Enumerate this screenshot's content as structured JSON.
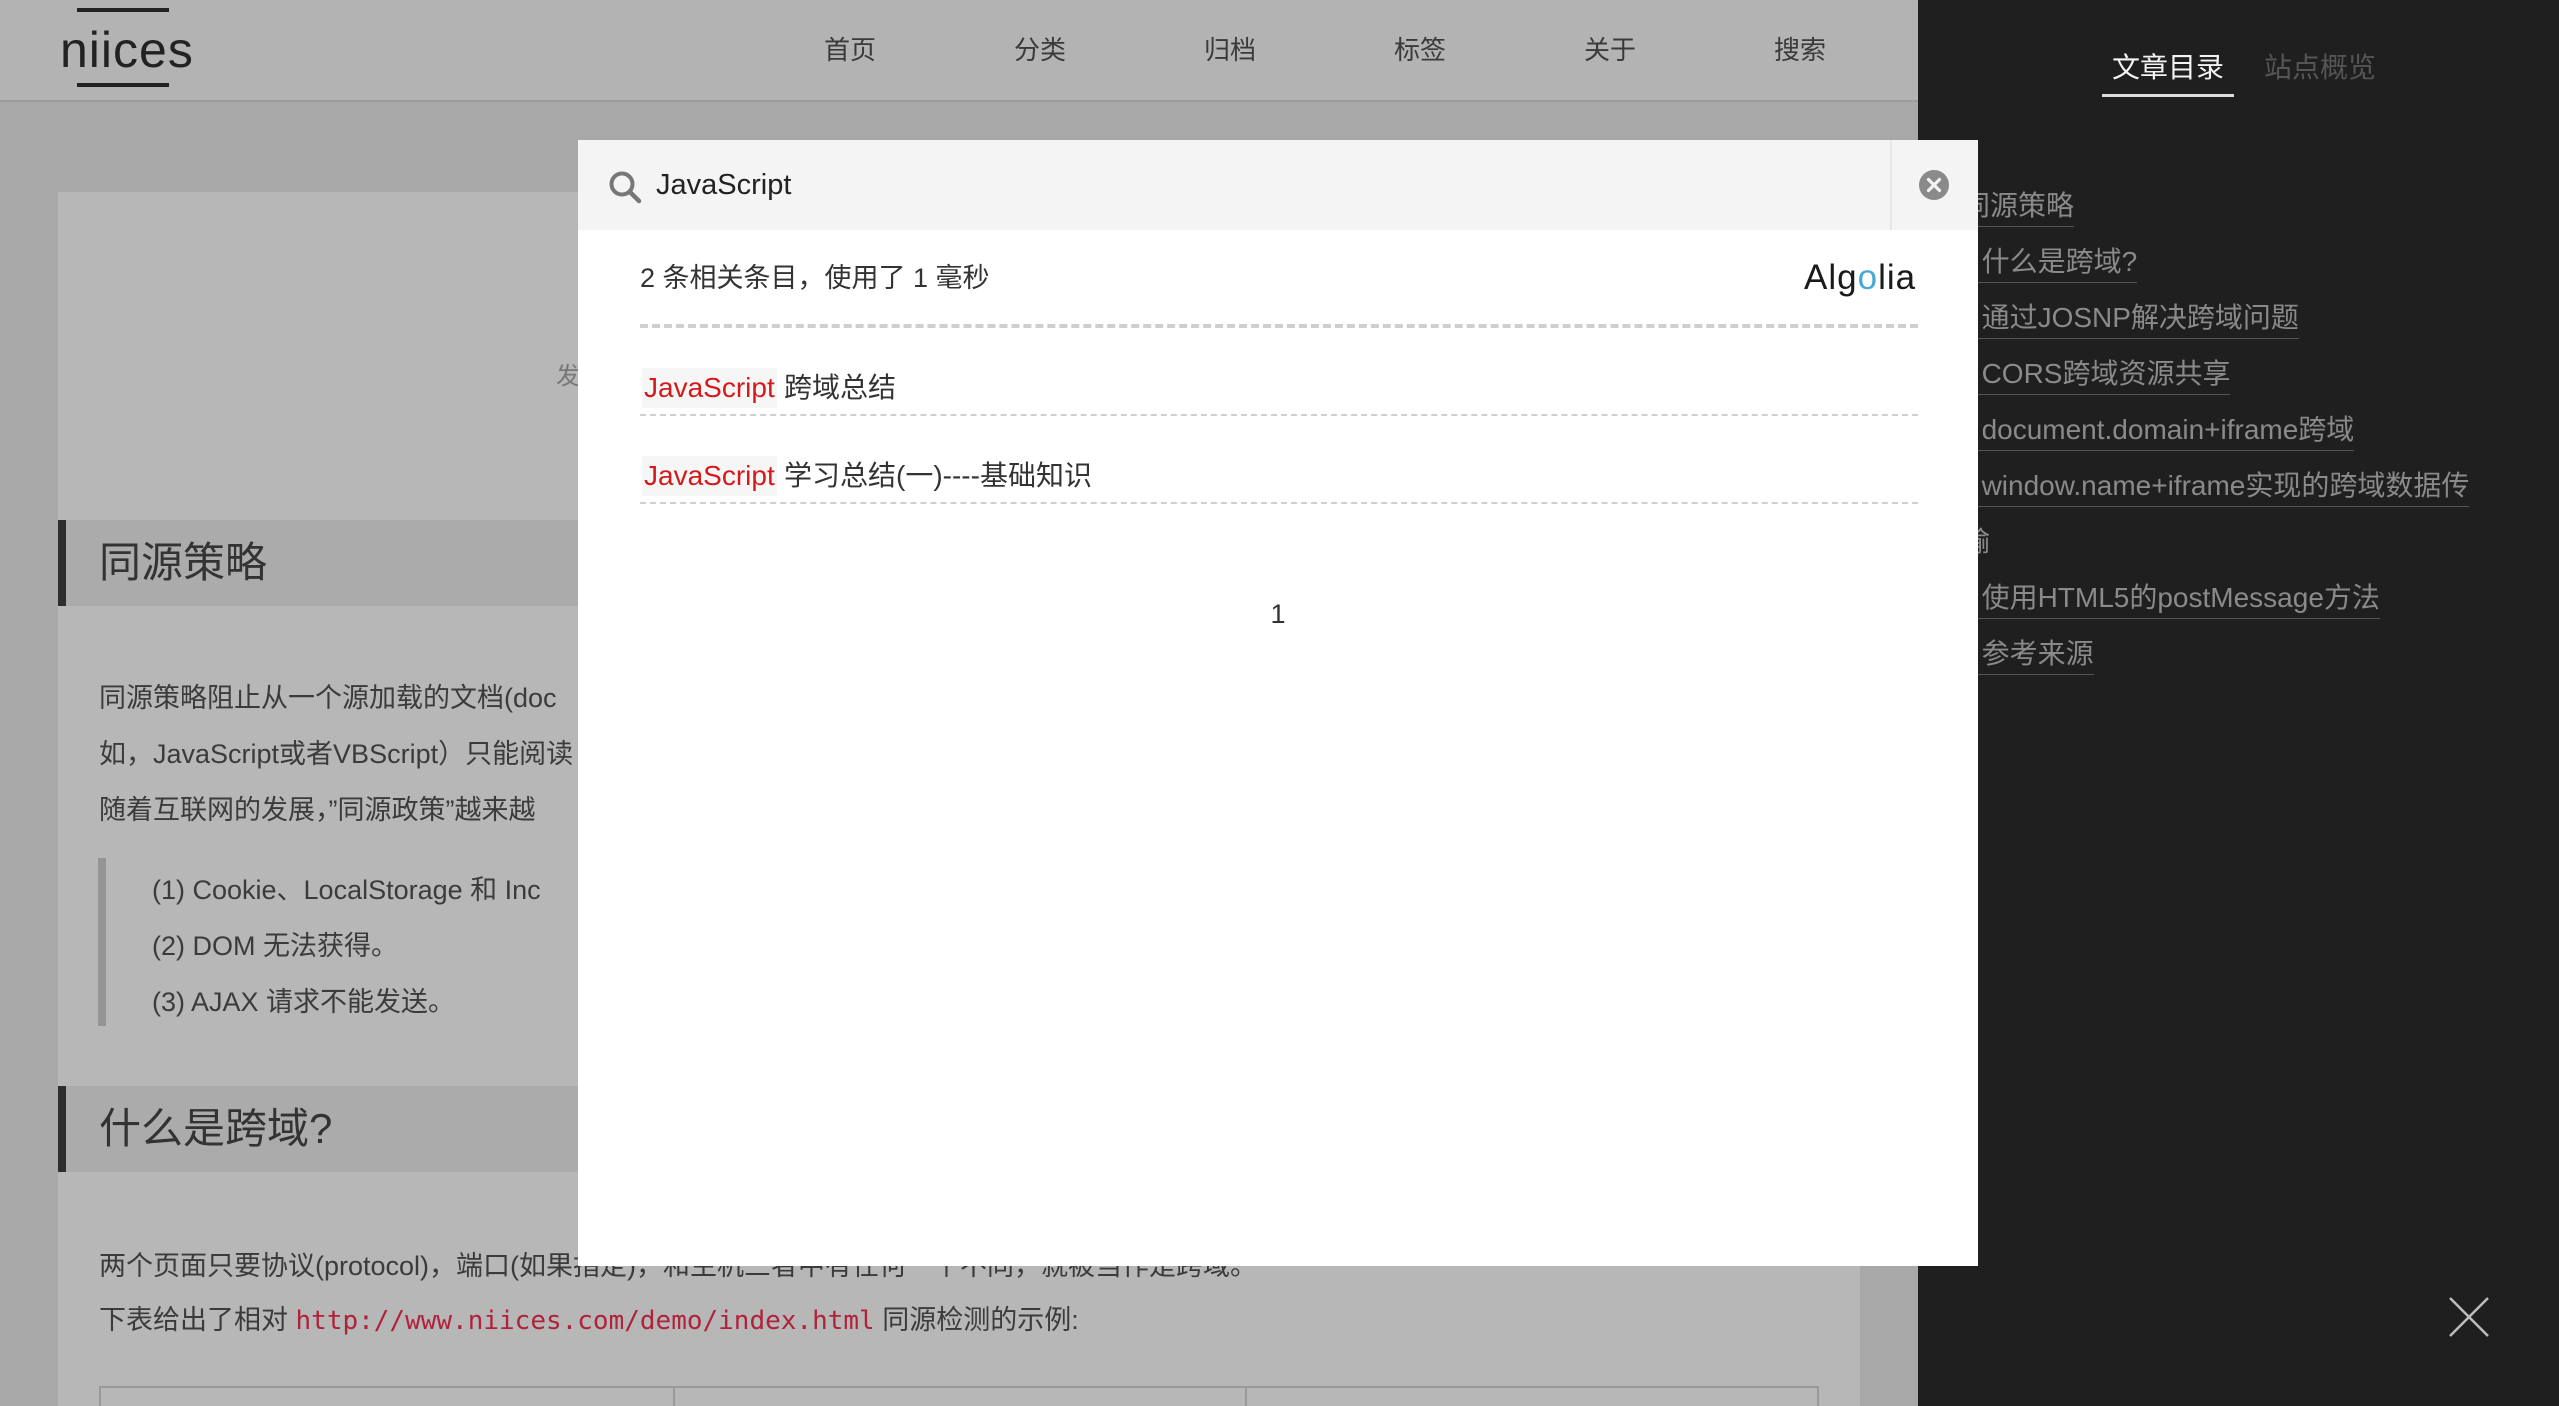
{
  "header": {
    "logo_text": "niices",
    "nav": [
      "首页",
      "分类",
      "归档",
      "标签",
      "关于",
      "搜索"
    ]
  },
  "article": {
    "meta_char": "发",
    "section1_title": "同源策略",
    "para1_line1": "同源策略阻止从一个源加载的文档(doc",
    "para1_line2": "如，JavaScript或者VBScript）只能阅读",
    "para1_line3": "随着互联网的发展，”同源政策”越来越",
    "quote_lines": [
      "(1)   Cookie、LocalStorage 和 Inc",
      "(2)   DOM 无法获得。",
      "(3)   AJAX 请求不能发送。"
    ],
    "section2_title": "什么是跨域?",
    "para2_line1": "两个页面只要协议(protocol)，端口(如果指定)，和主机三者中有任何一个不同，就被当作是跨域。",
    "para2_line2_before": "下表给出了相对 ",
    "para2_line2_code": "http://www.niices.com/demo/index.html",
    "para2_line2_after": " 同源检测的示例:"
  },
  "sidebar": {
    "tab_toc": "文章目录",
    "tab_overview": "站点概览",
    "toc": [
      "同源策略",
      "什么是跨域?",
      "通过JOSNP解决跨域问题",
      "CORS跨域资源共享",
      "document.domain+iframe跨域",
      "window.name+iframe实现的跨域数据传",
      "输",
      "使用HTML5的postMessage方法",
      "参考来源"
    ],
    "toc_prefixes": [
      " ",
      ". ",
      ". ",
      ". ",
      ". ",
      ". ",
      " ",
      ". ",
      ". "
    ]
  },
  "search": {
    "query": "JavaScript",
    "stats": "2 条相关条目，使用了 1 毫秒",
    "provider_pre": "Alg",
    "provider_o": "o",
    "provider_post": "lia",
    "results": [
      {
        "highlight": "JavaScript",
        "rest": "跨域总结"
      },
      {
        "highlight": "JavaScript",
        "rest": "学习总结(一)----基础知识"
      }
    ],
    "page": "1"
  },
  "icons": {
    "search": "search-icon",
    "clear": "clear-circle-icon",
    "close": "close-icon"
  },
  "colors": {
    "highlight": "#d41a1a",
    "sidebar_bg": "#1f1f1f",
    "overlay": "#a8a8a8",
    "algolia_accent": "#47a8d8"
  }
}
